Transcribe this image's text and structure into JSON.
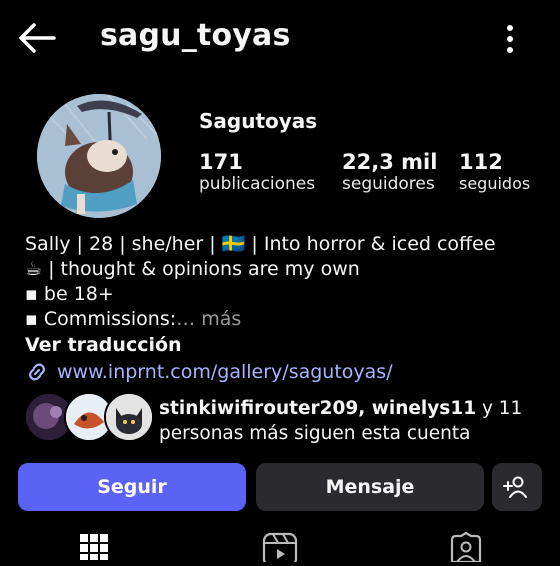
{
  "header": {
    "username": "sagu_toyas",
    "back_icon": "arrow-left-icon",
    "menu_icon": "more-vertical-icon"
  },
  "profile": {
    "display_name": "Sagutoyas",
    "stats": [
      {
        "value": "171",
        "label": "publicaciones"
      },
      {
        "value": "22,3 mil",
        "label": "seguidores"
      },
      {
        "value": "112",
        "label": "seguidos"
      }
    ]
  },
  "bio": {
    "line1": "Sally | 28 | she/her | 🇸🇪 | Into horror & iced coffee",
    "line2": "☕ | thought & opinions are my own",
    "line3": "▪ be 18+",
    "line4": "▪ Commissions:",
    "more": "… más",
    "translate": "Ver traducción",
    "link": "www.inprnt.com/gallery/sagutoyas/"
  },
  "followed_by": {
    "names": "stinkiwifirouter209, winelys11",
    "rest_line1": " y 11",
    "line2": "personas más siguen esta cuenta"
  },
  "actions": {
    "follow": "Seguir",
    "message": "Mensaje"
  },
  "colors": {
    "background": "#000000",
    "follow_button": "#5b63f5",
    "secondary_button": "#2b2b2f",
    "link": "#a6b4ff"
  },
  "tabs": [
    "grid-icon",
    "reels-icon",
    "tagged-icon"
  ]
}
